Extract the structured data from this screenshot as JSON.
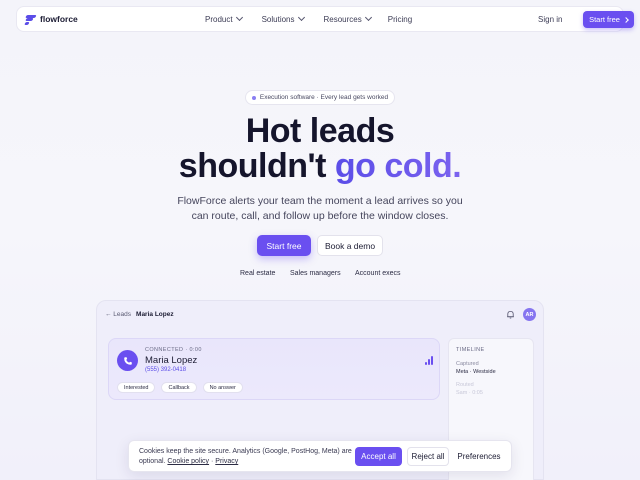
{
  "nav": {
    "brand": "flowforce",
    "links": [
      {
        "label": "Product",
        "has_menu": true
      },
      {
        "label": "Solutions",
        "has_menu": true
      },
      {
        "label": "Resources",
        "has_menu": true
      },
      {
        "label": "Pricing",
        "has_menu": false
      }
    ],
    "sign_in": "Sign in",
    "start_free": "Start free"
  },
  "hero": {
    "badge": "Execution software · Every lead gets worked",
    "headline_line1": "Hot leads",
    "headline_line2_plain": "shouldn't ",
    "headline_line2_accent": "go cold.",
    "subtitle_line1": "FlowForce alerts your team the moment a lead arrives so you",
    "subtitle_line2": "can route, call, and follow up before the window closes.",
    "primary_cta": "Start free",
    "secondary_cta": "Book a demo",
    "audiences": [
      "Real estate",
      "Sales managers",
      "Account execs"
    ]
  },
  "preview": {
    "breadcrumb_parent": "← Leads",
    "breadcrumb_current": "Maria Lopez",
    "avatar_initials": "AR",
    "call": {
      "status": "CONNECTED · 0:00",
      "name": "Maria Lopez",
      "phone": "(555) 392-0418",
      "dispositions": [
        "Interested",
        "Callback",
        "No answer"
      ]
    },
    "timeline": {
      "title": "TIMELINE",
      "entries": [
        {
          "label": "Captured",
          "value": "Meta · Westside"
        },
        {
          "label": "Routed",
          "value": "Sam · 0:05"
        }
      ]
    }
  },
  "cookie": {
    "text": "Cookies keep the site secure. Analytics (Google, PostHog, Meta) are optional.",
    "policy_link": "Cookie policy",
    "separator": " · ",
    "privacy_link": "Privacy",
    "accept": "Accept all",
    "reject": "Reject all",
    "preferences": "Preferences"
  },
  "colors": {
    "accent": "#6a4ff0",
    "text": "#14142b",
    "background": "#f4f4fa"
  }
}
